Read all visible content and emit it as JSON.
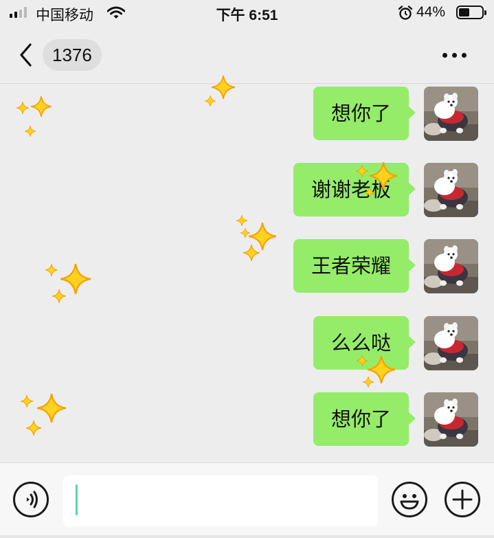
{
  "status_bar": {
    "carrier": "中国移动",
    "time": "下午 6:51",
    "battery_percent": "44%",
    "battery_level": 0.44,
    "signal_bars_filled": 2,
    "signal_bars_total": 4,
    "icons": [
      "signal-icon",
      "wifi-icon",
      "alarm-icon",
      "battery-icon"
    ]
  },
  "nav": {
    "title": "1376",
    "back_icon": "chevron-left-icon",
    "more_icon": "more-icon"
  },
  "messages": [
    {
      "text": "想你了",
      "sender": "me"
    },
    {
      "text": "谢谢老板",
      "sender": "me"
    },
    {
      "text": "王者荣耀",
      "sender": "me"
    },
    {
      "text": "么么哒",
      "sender": "me"
    },
    {
      "text": "想你了",
      "sender": "me"
    }
  ],
  "input_bar": {
    "value": "",
    "icons": [
      "voice-icon",
      "emoji-icon",
      "plus-icon"
    ]
  },
  "colors": {
    "background": "#ededed",
    "bubble": "#95ec69",
    "sparkle": "#ffd21f",
    "sparkle_outline": "#f5a300",
    "caret": "#5fd4a8"
  }
}
